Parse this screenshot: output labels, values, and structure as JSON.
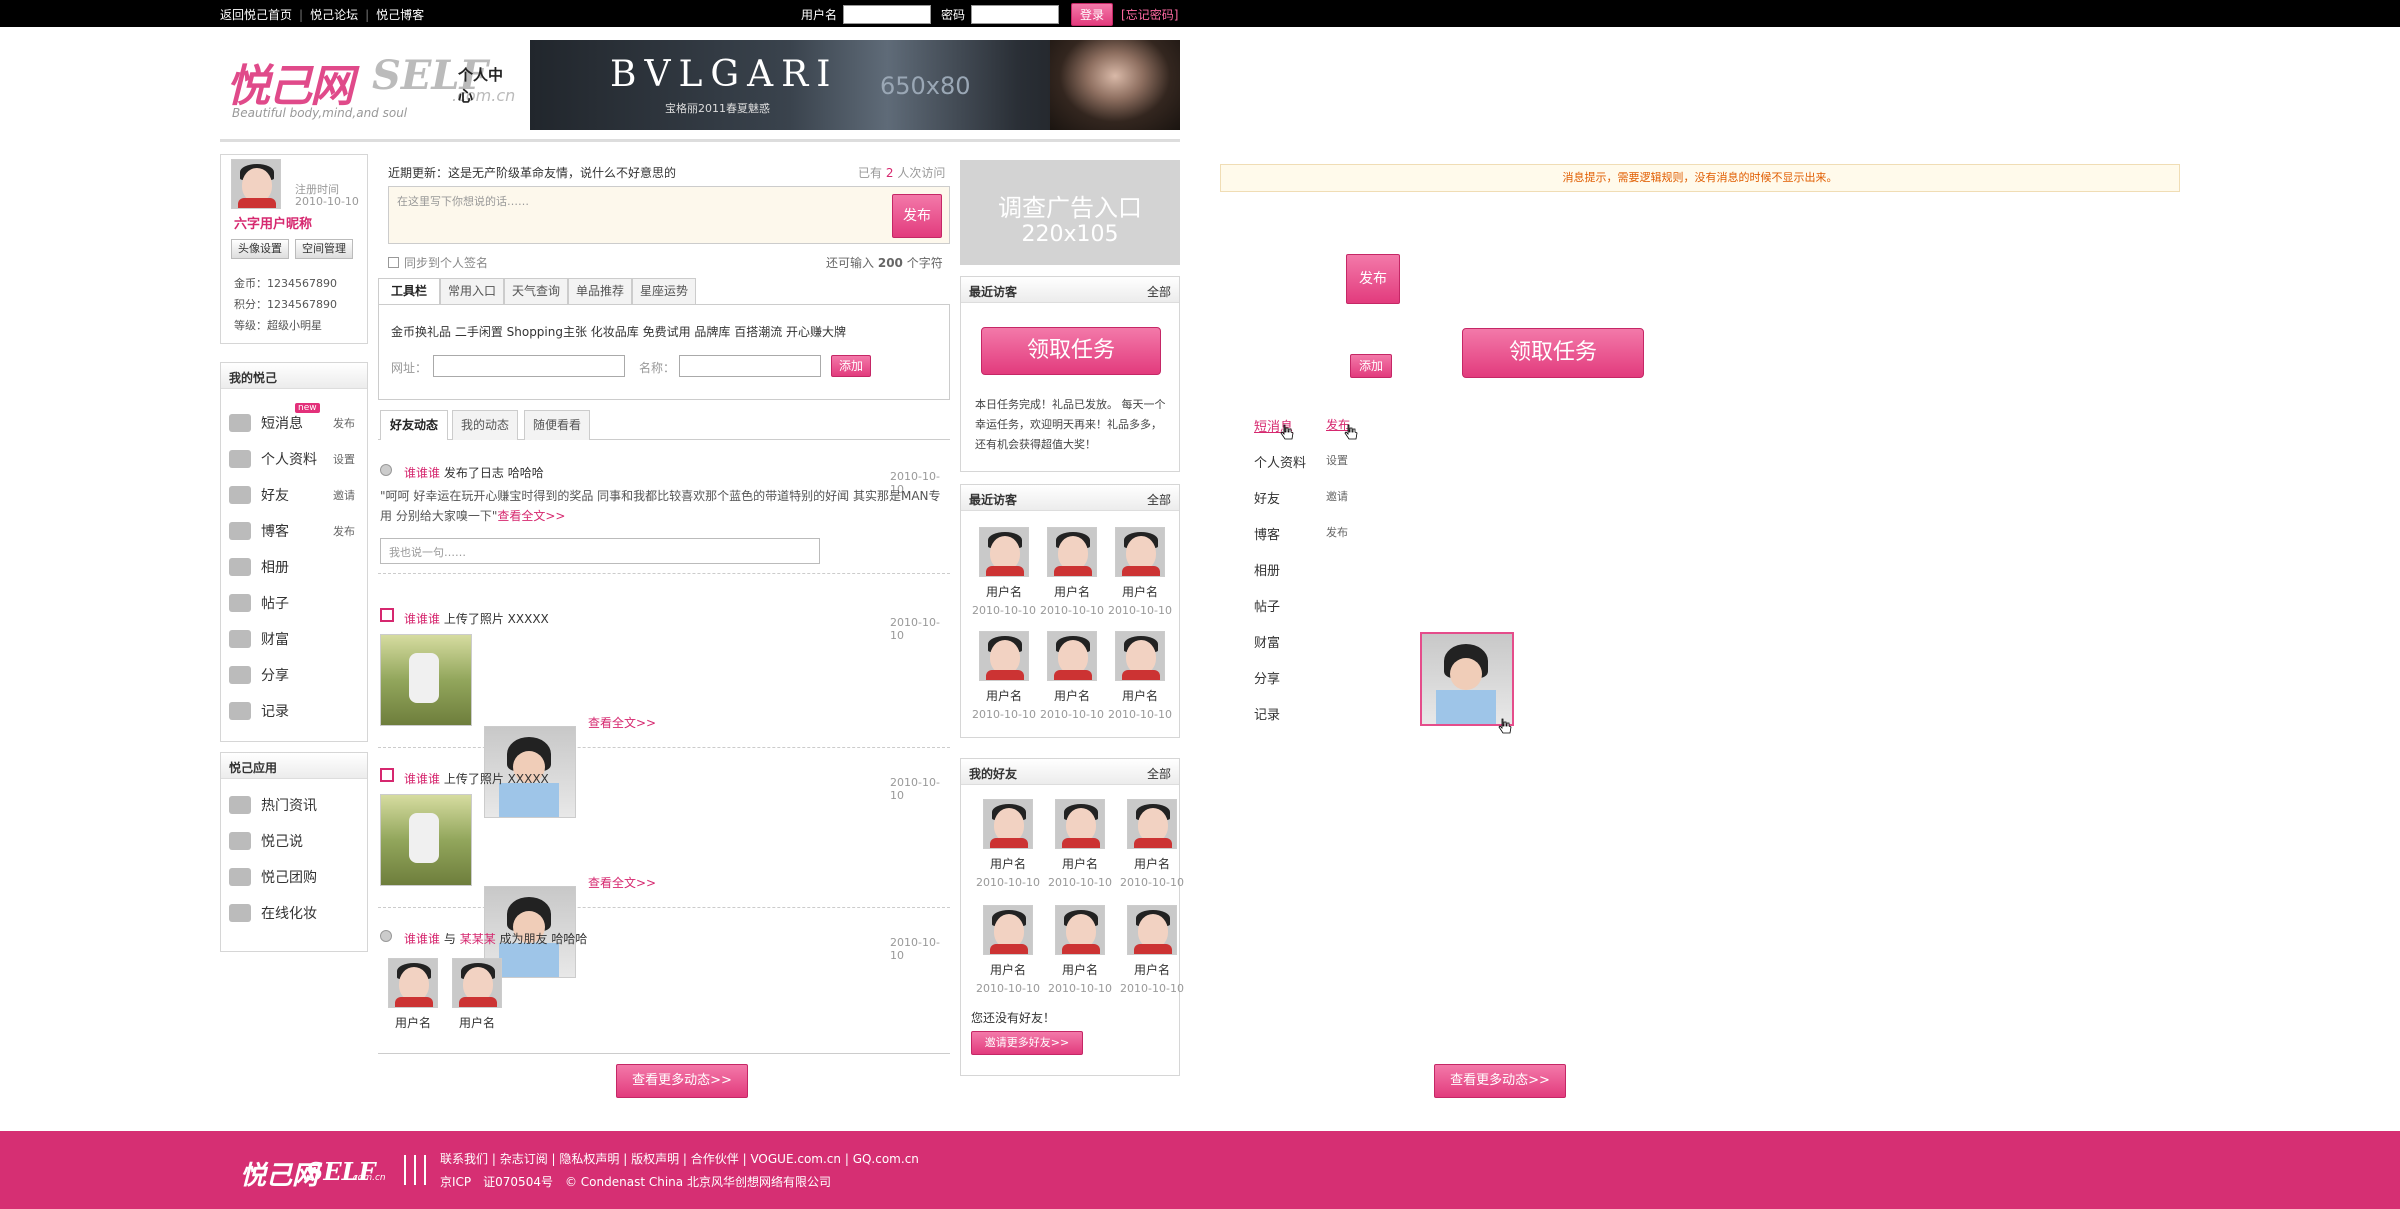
{
  "topbar": {
    "links": [
      "返回悦己首页",
      "悦己论坛",
      "悦己博客"
    ],
    "username_label": "用户名",
    "password_label": "密码",
    "login_button": "登录",
    "forgot": "[忘记密码]"
  },
  "header": {
    "logo_cn": "悦己网",
    "logo_en": "SELF",
    "logo_domain": ".com.cn",
    "logo_section": "个人中心",
    "logo_slogan": "Beautiful body,mind,and soul",
    "banner_brand": "BVLGARI",
    "banner_sub": "宝格丽2011春夏魅惑",
    "banner_size": "650x80"
  },
  "profile": {
    "reg_label": "注册时间",
    "reg_date": "2010-10-10",
    "nickname": "六字用户昵称",
    "btn_avatar": "头像设置",
    "btn_space": "空间管理",
    "gold": "金币：1234567890",
    "points": "积分：1234567890",
    "level": "等级：超级小明星"
  },
  "my_yueji": {
    "title": "我的悦己",
    "new_badge": "new",
    "items": [
      {
        "label": "短消息",
        "action": "发布",
        "icon": "message-icon"
      },
      {
        "label": "个人资料",
        "action": "设置",
        "icon": "profile-icon"
      },
      {
        "label": "好友",
        "action": "邀请",
        "icon": "friends-icon"
      },
      {
        "label": "博客",
        "action": "发布",
        "icon": "pen-icon"
      },
      {
        "label": "相册",
        "action": "",
        "icon": "album-icon"
      },
      {
        "label": "帖子",
        "action": "",
        "icon": "post-icon"
      },
      {
        "label": "财富",
        "action": "",
        "icon": "piggy-bank-icon"
      },
      {
        "label": "分享",
        "action": "",
        "icon": "share-icon"
      },
      {
        "label": "记录",
        "action": "",
        "icon": "record-icon"
      }
    ]
  },
  "yueji_apps": {
    "title": "悦己应用",
    "items": [
      {
        "label": "热门资讯",
        "icon": "news-icon"
      },
      {
        "label": "悦己说",
        "icon": "say-icon"
      },
      {
        "label": "悦己团购",
        "icon": "tag-icon"
      },
      {
        "label": "在线化妆",
        "icon": "makeup-icon"
      }
    ]
  },
  "status": {
    "recent_label": "近期更新：",
    "recent_text": "这是无产阶级革命友情，说什么不好意思的",
    "visits_prefix": "已有",
    "visits_count": "2",
    "visits_suffix": "人次访问",
    "placeholder": "在这里写下你想说的话……",
    "publish": "发布",
    "sync_label": "同步到个人签名",
    "remain_prefix": "还可输入",
    "remain_count": "200",
    "remain_suffix": "个字符"
  },
  "toolbar": {
    "tabs": [
      "工具栏",
      "常用入口",
      "天气查询",
      "单品推荐",
      "星座运势"
    ],
    "links": "金币换礼品 二手闲置 Shopping主张 化妆品库 免费试用 品牌库 百搭潮流 开心赚大牌",
    "url_label": "网址：",
    "name_label": "名称：",
    "add": "添加"
  },
  "feed": {
    "tabs": [
      "好友动态",
      "我的动态",
      "随便看看"
    ],
    "item1": {
      "user": "谁谁谁",
      "action": "发布了日志",
      "title": "哈哈哈",
      "date": "2010-10-10",
      "text": "\"呵呵 好幸运在玩开心赚宝时得到的奖品 同事和我都比较喜欢那个蓝色的带道特别的好闻 其实那是MAN专用 分别给大家嗅一下\"",
      "more": "查看全文>>",
      "comment_placeholder": "我也说一句……"
    },
    "item2": {
      "user": "谁谁谁",
      "action": "上传了照片 XXXXX",
      "date": "2010-10-10",
      "more": "查看全文>>"
    },
    "item3": {
      "user": "谁谁谁",
      "action": "上传了照片 XXXXX",
      "date": "2010-10-10",
      "more": "查看全文>>"
    },
    "item4": {
      "user": "谁谁谁",
      "mid": "与",
      "friend": "某某某",
      "action": "成为朋友",
      "title": "哈哈哈",
      "date": "2010-10-10",
      "names": [
        "用户名",
        "用户名"
      ]
    },
    "more_button": "查看更多动态>>"
  },
  "right": {
    "survey_ad": "调查广告入口",
    "survey_size": "220x105",
    "box1_title": "最近访客",
    "box1_more": "全部",
    "task_button": "领取任务",
    "task_text": "本日任务完成！礼品已发放。 每天一个幸运任务，欢迎明天再来！礼品多多，还有机会获得超值大奖！",
    "box2_title": "最近访客",
    "box2_more": "全部",
    "visitors": [
      {
        "name": "用户名",
        "date": "2010-10-10"
      },
      {
        "name": "用户名",
        "date": "2010-10-10"
      },
      {
        "name": "用户名",
        "date": "2010-10-10"
      },
      {
        "name": "用户名",
        "date": "2010-10-10"
      },
      {
        "name": "用户名",
        "date": "2010-10-10"
      },
      {
        "name": "用户名",
        "date": "2010-10-10"
      }
    ],
    "box3_title": "我的好友",
    "box3_more": "全部",
    "friends": [
      {
        "name": "用户名",
        "date": "2010-10-10"
      },
      {
        "name": "用户名",
        "date": "2010-10-10"
      },
      {
        "name": "用户名",
        "date": "2010-10-10"
      },
      {
        "name": "用户名",
        "date": "2010-10-10"
      },
      {
        "name": "用户名",
        "date": "2010-10-10"
      },
      {
        "name": "用户名",
        "date": "2010-10-10"
      }
    ],
    "no_friends": "您还没有好友！",
    "invite_button": "邀请更多好友>>"
  },
  "states": {
    "notice": "消息提示，需要逻辑规则，没有消息的时候不显示出来。",
    "publish": "发布",
    "task": "领取任务",
    "add": "添加",
    "menu": [
      {
        "label": "短消息",
        "action": "发布"
      },
      {
        "label": "个人资料",
        "action": "设置"
      },
      {
        "label": "好友",
        "action": "邀请"
      },
      {
        "label": "博客",
        "action": "发布"
      },
      {
        "label": "相册",
        "action": ""
      },
      {
        "label": "帖子",
        "action": ""
      },
      {
        "label": "财富",
        "action": ""
      },
      {
        "label": "分享",
        "action": ""
      },
      {
        "label": "记录",
        "action": ""
      }
    ],
    "more": "查看更多动态>>"
  },
  "footer": {
    "logo_cn": "悦己网",
    "logo_en": "SELF",
    "logo_domain": ".com.cn",
    "links": [
      "联系我们",
      "杂志订阅",
      "隐私权声明",
      "版权声明",
      "合作伙伴",
      "VOGUE.com.cn",
      "GQ.com.cn"
    ],
    "icp": "京ICP　证070504号",
    "copyright": "© Condenast China 北京风华创想网络有限公司"
  },
  "colors": {
    "accent": "#d6286f",
    "footer": "#d62f73",
    "topbar": "#000000"
  }
}
